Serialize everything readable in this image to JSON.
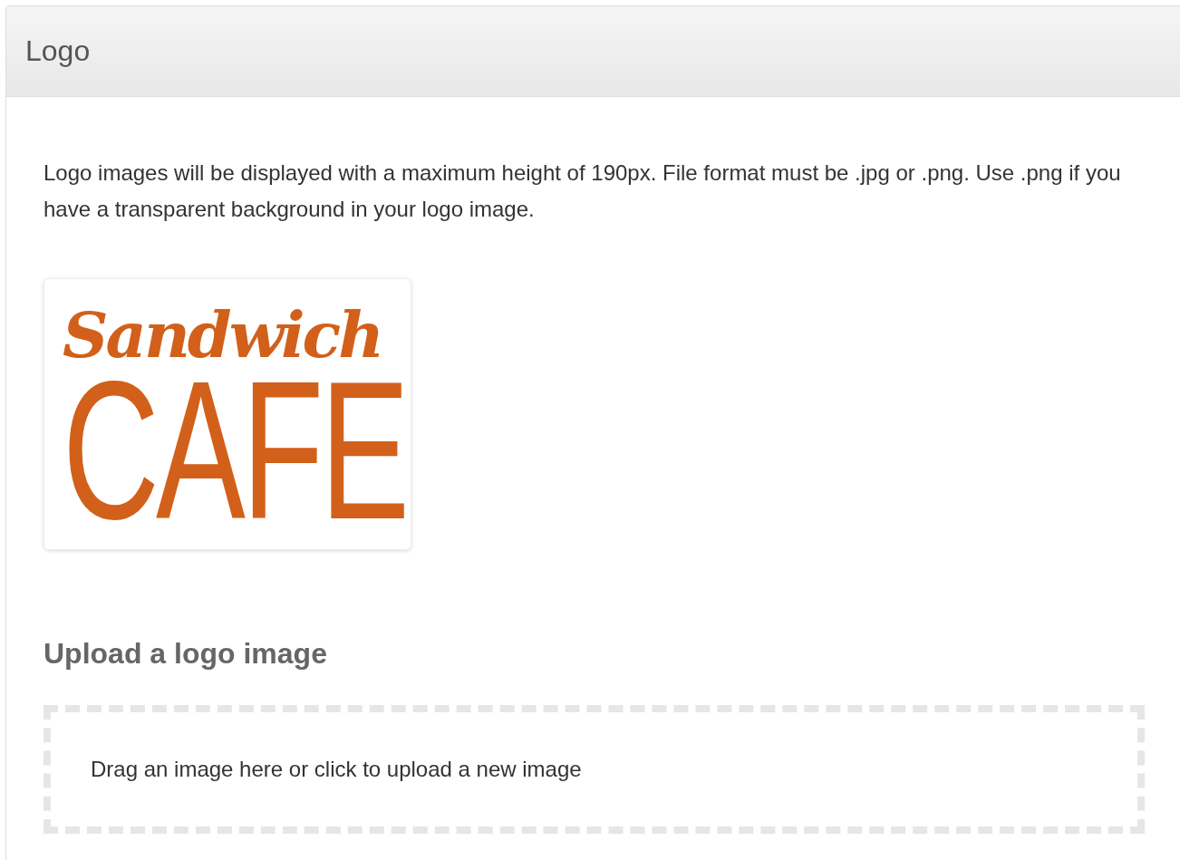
{
  "panel": {
    "title": "Logo"
  },
  "description": "Logo images will be displayed with a maximum height of 190px. File format must be .jpg or .png. Use .png if you have a transparent background in your logo image.",
  "logo": {
    "line_1": "Sandwich",
    "line_2": "CAFE"
  },
  "upload": {
    "heading": "Upload a logo image",
    "dropzone_text": "Drag an image here or click to upload a new image"
  }
}
